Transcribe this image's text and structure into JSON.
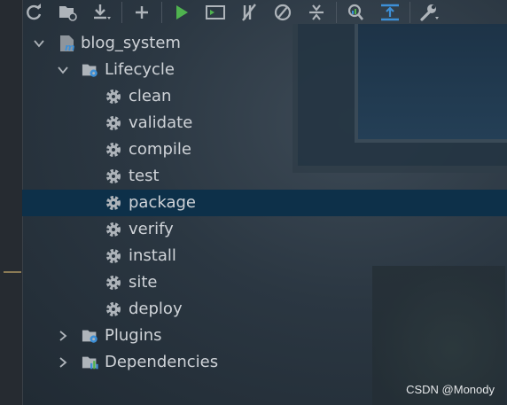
{
  "toolbar": {
    "buttons": [
      {
        "icon": "refresh-icon"
      },
      {
        "icon": "open-folder-sync-icon"
      },
      {
        "icon": "download-icon"
      },
      {
        "icon": "add-icon"
      },
      {
        "icon": "run-icon"
      },
      {
        "icon": "run-config-icon"
      },
      {
        "icon": "toggle-offline-icon"
      },
      {
        "icon": "skip-tests-icon"
      },
      {
        "icon": "collapse-all-icon"
      },
      {
        "icon": "analyze-dependencies-icon"
      },
      {
        "icon": "show-dependencies-icon"
      },
      {
        "icon": "settings-wrench-icon"
      }
    ]
  },
  "tree": {
    "project": {
      "label": "blog_system",
      "icon": "maven-module-icon",
      "expanded": true
    },
    "lifecycle": {
      "label": "Lifecycle",
      "icon": "lifecycle-folder-icon",
      "expanded": true,
      "goals": [
        {
          "label": "clean"
        },
        {
          "label": "validate"
        },
        {
          "label": "compile"
        },
        {
          "label": "test"
        },
        {
          "label": "package",
          "selected": true
        },
        {
          "label": "verify"
        },
        {
          "label": "install"
        },
        {
          "label": "site"
        },
        {
          "label": "deploy"
        }
      ]
    },
    "plugins": {
      "label": "Plugins",
      "icon": "plugins-folder-icon",
      "expanded": false
    },
    "dependencies": {
      "label": "Dependencies",
      "icon": "dependencies-folder-icon",
      "expanded": false
    }
  },
  "watermark": "CSDN @Monody",
  "colors": {
    "selection": "#0d3049",
    "run_green": "#4fb34f",
    "icon_gray": "#aeb4ba",
    "accent_blue": "#3d8fd6"
  }
}
